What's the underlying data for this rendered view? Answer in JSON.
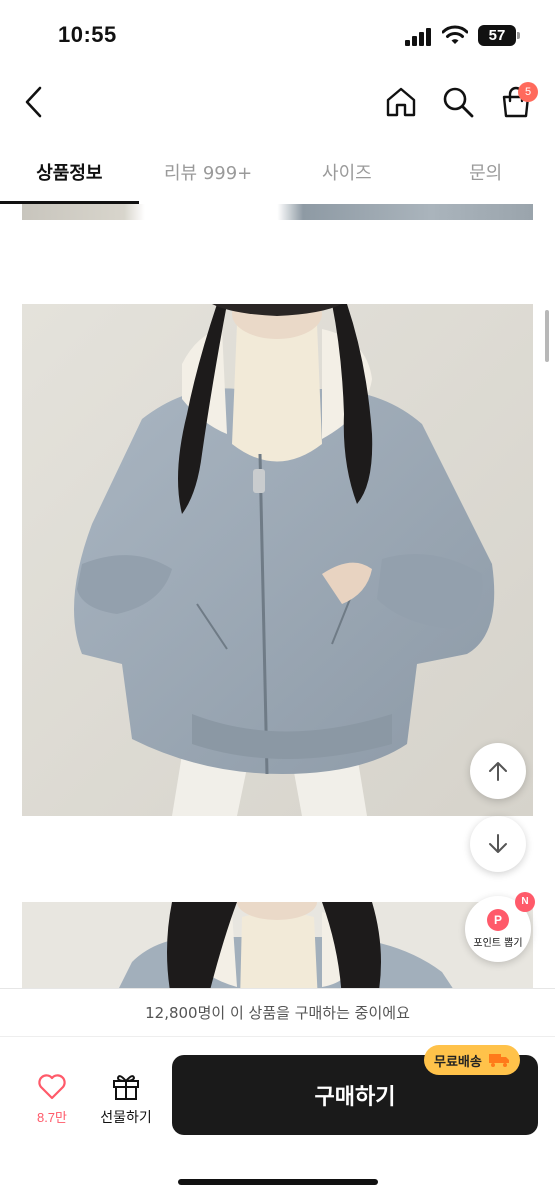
{
  "status_bar": {
    "time": "10:55",
    "battery_level": "57"
  },
  "header": {
    "back_icon": "chevron-left-icon",
    "home_icon": "home-icon",
    "search_icon": "search-icon",
    "cart_icon": "shopping-bag-icon",
    "cart_count": "5"
  },
  "tabs": [
    {
      "label": "상품정보",
      "active": true
    },
    {
      "label": "리뷰 999+",
      "active": false
    },
    {
      "label": "사이즈",
      "active": false
    },
    {
      "label": "문의",
      "active": false
    }
  ],
  "floating": {
    "scroll_up_icon": "arrow-up-icon",
    "scroll_down_icon": "arrow-down-icon",
    "point_badge": "P",
    "point_label": "포인트 뽑기",
    "new_badge": "N"
  },
  "buyers_banner": {
    "text": "12,800명이 이 상품을 구매하는 중이에요"
  },
  "bottom_bar": {
    "like_icon": "heart-icon",
    "like_count": "8.7만",
    "gift_icon": "gift-icon",
    "gift_label": "선물하기",
    "buy_label": "구매하기",
    "free_shipping_label": "무료배송",
    "truck_icon": "truck-icon"
  },
  "colors": {
    "accent": "#ff5a6a",
    "cart_badge": "#ff6a5c",
    "buy_button": "#1a1a1a",
    "free_shipping": "#ffc24a",
    "jacket": "#9eabb8"
  }
}
